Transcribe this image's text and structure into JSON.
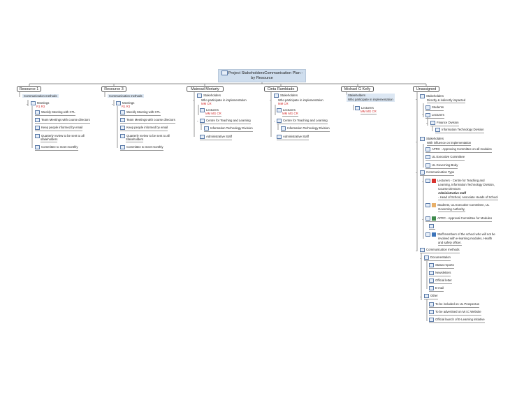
{
  "root": {
    "title_line1": "Project StakeholdersCommunication Plan -",
    "title_line2": "by Resource"
  },
  "resources": [
    "Resource 1",
    "Resource 3",
    "Mairead Moriarty",
    "Cinta Rambiado",
    "Michael G Kelly",
    "Unassigned"
  ],
  "r1": {
    "comm": "Communication methods",
    "meetings": "Meetings",
    "meetings_code": "R1 R3",
    "items": [
      "Weekly Meeting with CTL",
      "Team Meetings with course directors",
      "Keep people informed by email",
      "Quarterly review to be sent to all",
      "stakeholders",
      "Committee to meet monthly"
    ]
  },
  "r3": {
    "comm": "Communication methods",
    "meetings": "Meetings",
    "meetings_code": "R1 R3",
    "items": [
      "Weekly Meeting with CTL",
      "Team Meetings with course directors",
      "Keep people informed by email",
      "Quarterly review to be sent to all",
      "Stakeholders",
      "Committee to meet monthly"
    ]
  },
  "mm": {
    "stakeholders": "Stakeholders",
    "participate": "Who participate in implementation",
    "code": "MM CR",
    "lecturers": "Lecturers",
    "lect_code": "MM MG CR",
    "centre": "Centre for Teaching and Learning",
    "itd": "Information Technology Division",
    "admin": "Administrative Staff"
  },
  "cr": {
    "stakeholders": "Stakeholders",
    "participate": "Who participate in implementation",
    "code": "MM CR",
    "lecturers": "Lecturers",
    "lect_code": "MM MG CR",
    "centre": "Centre for Teaching and Learning",
    "itd": "Information Technology Division",
    "admin": "Administrative Staff"
  },
  "mk": {
    "stakeholders": "Stakeholders",
    "participate": "Who participate in implementation",
    "lecturers": "Lecturers",
    "lect_code": "MM MG CR"
  },
  "un": {
    "stakeholders": "Stakeholders",
    "direct": "Directly & indirectly impacted",
    "students": "Students",
    "lecturers": "Lecturers",
    "finance": "Finance Division",
    "itd": "Information Technology Division",
    "stake2": "Stakeholders",
    "influence": "With influence on implementation",
    "aprc": "APRC - Approving Committee on all modules",
    "ulexec": "UL Executive Committee",
    "ulgov": "UL Governing Body",
    "commtype": "Communication Type",
    "ct1": [
      "Lecturers - Centre for Teaching and",
      "Learning, Information Technology Division,",
      "Course Directors"
    ],
    "ct1b": "Administrative staff",
    "ct1c": "- Head of School, Associate Heads of School",
    "ct2": [
      "Students, UL Executive Committee, UL",
      "Governing Authority,"
    ],
    "ct3": "APRC - Approval Committee for Modules",
    "ct4": [
      "Staff members of the school who will not be",
      "involved with e-learning modules, Health",
      "and safety officer."
    ],
    "commmethods": "Communication methods",
    "documentation": "Documentation",
    "docs": [
      "Status reports",
      "Newsletters",
      "Official letter",
      "E-mail"
    ],
    "other": "Other",
    "others": [
      "To be included on UL Prospectus",
      "To be advertised on M.I.C Website",
      "Official launch of E-Learning initiative"
    ]
  },
  "colors": {
    "red": "#d22a2a",
    "highlight": "#dce7f3",
    "square_red": "#d8332f",
    "square_orange": "#e8b06a",
    "square_green": "#3f8a4c",
    "square_blue": "#3b73b9"
  }
}
